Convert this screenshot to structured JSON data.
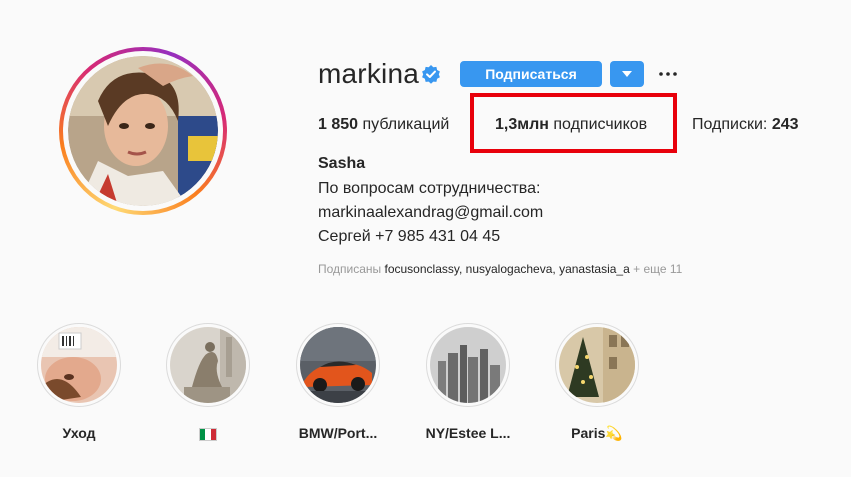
{
  "profile": {
    "username": "markina",
    "verified_icon": "verified-badge-icon",
    "follow_label": "Подписаться",
    "dropdown_icon": "caret-down-icon",
    "more_icon": "ellipsis-icon"
  },
  "stats": {
    "posts_count": "1 850",
    "posts_label": " публикаций",
    "followers_count": "1,3млн",
    "followers_label": " подписчиков",
    "following_label": "Подписки: ",
    "following_count": "243"
  },
  "bio": {
    "name": "Sasha",
    "line1": "По вопросам сотрудничества:",
    "line2": "markinaalexandrag@gmail.com",
    "line3": "Сергей +7 985 431 04 45"
  },
  "followed_by": {
    "prefix": "Подписаны ",
    "account1": "focusonclassy",
    "sep1": ", ",
    "account2": "nusyalogacheva",
    "sep2": ", ",
    "account3": "yanastasia_a",
    "more": " + еще 11"
  },
  "highlights": [
    {
      "label": "Уход"
    },
    {
      "label": "🇮🇹"
    },
    {
      "label": "BMW/Port..."
    },
    {
      "label": "NY/Estee L..."
    },
    {
      "label": "Paris💫"
    }
  ],
  "colors": {
    "accent": "#3897f0",
    "highlight_box": "#e8000b",
    "text": "#262626",
    "muted": "#999999",
    "background": "#fafafa"
  }
}
